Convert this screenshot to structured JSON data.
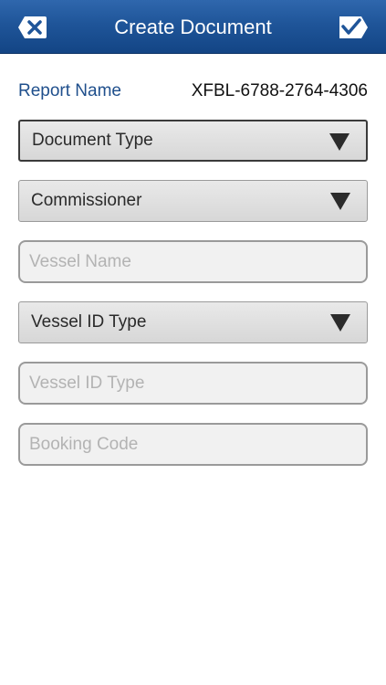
{
  "header": {
    "title": "Create Document",
    "cancel_icon": "close-x-icon",
    "confirm_icon": "checkmark-icon"
  },
  "report": {
    "label": "Report Name",
    "value": "XFBL-6788-2764-4306"
  },
  "fields": {
    "document_type": {
      "label": "Document Type"
    },
    "commissioner": {
      "label": "Commissioner"
    },
    "vessel_name": {
      "value": "",
      "placeholder": "Vessel Name"
    },
    "vessel_id_type_select": {
      "label": "Vessel ID Type"
    },
    "vessel_id_type_input": {
      "value": "",
      "placeholder": "Vessel ID Type"
    },
    "booking_code": {
      "value": "",
      "placeholder": "Booking Code"
    }
  },
  "colors": {
    "header_blue": "#1f5599",
    "label_blue": "#1f4f8c"
  }
}
